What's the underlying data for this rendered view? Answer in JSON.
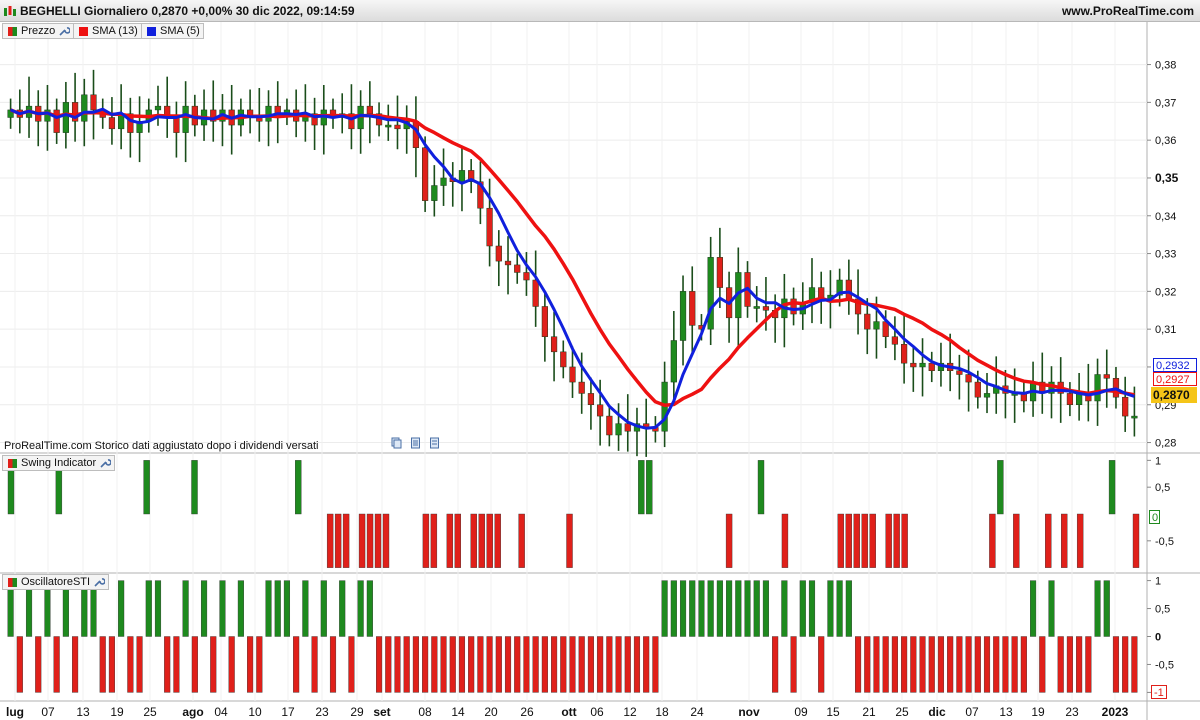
{
  "header": {
    "title": "BEGHELLI Giornaliero 0,2870 +0,00% 30 dic 2022, 09:14:59",
    "site": "www.ProRealTime.com"
  },
  "legend_price": {
    "prezzo": "Prezzo",
    "sma13": "SMA (13)",
    "sma5": "SMA (5)"
  },
  "legend_swing": "Swing Indicator",
  "legend_osc": "OscillatoreSTI",
  "note": "ProRealTime.com Storico dati aggiustato dopo i dividendi versati",
  "price_tags": {
    "sma5": "0,2932",
    "sma13": "0,2927",
    "last": "0,2870"
  },
  "swing_zero_tag": "0",
  "osc_min_tag": "-1",
  "colors": {
    "up": "#1e8a1e",
    "down": "#e0201a",
    "sma13": "#ee1111",
    "sma5": "#1020dd",
    "last_tag_bg": "#f5c518"
  },
  "icons": [
    "chart-app-icon",
    "wrench-icon",
    "copy-icon",
    "document-icon"
  ],
  "chart_data": [
    {
      "type": "candlestick",
      "title": "BEGHELLI Giornaliero",
      "y_ticks": [
        "0,28",
        "0,29",
        "0,3",
        "0,31",
        "0,32",
        "0,33",
        "0,34",
        "0,35",
        "0,36",
        "0,37",
        "0,38"
      ],
      "ylim": [
        0.2775,
        0.3865
      ],
      "x_ticks": [
        "lug",
        "07",
        "13",
        "19",
        "25",
        "ago",
        "04",
        "10",
        "17",
        "23",
        "29",
        "set",
        "08",
        "14",
        "20",
        "26",
        "ott",
        "06",
        "12",
        "18",
        "24",
        "nov",
        "09",
        "15",
        "21",
        "25",
        "dic",
        "07",
        "13",
        "19",
        "23",
        "2023"
      ],
      "series": [
        {
          "name": "Prezzo",
          "close": [
            0.368,
            0.366,
            0.369,
            0.365,
            0.368,
            0.362,
            0.37,
            0.365,
            0.372,
            0.368,
            0.366,
            0.363,
            0.367,
            0.362,
            0.365,
            0.368,
            0.369,
            0.366,
            0.362,
            0.369,
            0.364,
            0.368,
            0.365,
            0.368,
            0.364,
            0.368,
            0.366,
            0.365,
            0.369,
            0.367,
            0.368,
            0.365,
            0.367,
            0.364,
            0.368,
            0.366,
            0.367,
            0.363,
            0.369,
            0.367,
            0.364,
            0.364,
            0.363,
            0.365,
            0.358,
            0.344,
            0.348,
            0.35,
            0.349,
            0.352,
            0.349,
            0.342,
            0.332,
            0.328,
            0.327,
            0.325,
            0.323,
            0.316,
            0.308,
            0.304,
            0.3,
            0.296,
            0.293,
            0.29,
            0.287,
            0.282,
            0.285,
            0.283,
            0.285,
            0.284,
            0.283,
            0.296,
            0.307,
            0.32,
            0.311,
            0.31,
            0.329,
            0.321,
            0.313,
            0.325,
            0.316,
            0.316,
            0.315,
            0.313,
            0.318,
            0.314,
            0.317,
            0.321,
            0.318,
            0.319,
            0.323,
            0.318,
            0.314,
            0.31,
            0.312,
            0.308,
            0.306,
            0.301,
            0.3,
            0.301,
            0.299,
            0.301,
            0.299,
            0.298,
            0.296,
            0.292,
            0.293,
            0.295,
            0.293,
            0.293,
            0.291,
            0.296,
            0.293,
            0.296,
            0.293,
            0.29,
            0.293,
            0.291,
            0.298,
            0.297,
            0.292,
            0.287,
            0.287
          ]
        },
        {
          "name": "SMA (13)",
          "last": 0.2927
        },
        {
          "name": "SMA (5)",
          "last": 0.2932
        }
      ],
      "last_price": 0.287
    },
    {
      "type": "bar",
      "title": "Swing Indicator",
      "y_ticks": [
        "1",
        "0,5",
        "-0,5"
      ],
      "ylim": [
        -1.1,
        1.1
      ],
      "values_note": "per-day values are +1 (green) or -1 (red) or 0",
      "values": [
        1,
        0,
        0,
        0,
        0,
        0,
        1,
        0,
        0,
        0,
        0,
        0,
        0,
        0,
        0,
        0,
        0,
        1,
        0,
        0,
        0,
        0,
        0,
        1,
        0,
        0,
        0,
        0,
        0,
        0,
        0,
        0,
        0,
        0,
        0,
        0,
        1,
        0,
        0,
        0,
        -1,
        -1,
        -1,
        0,
        -1,
        -1,
        -1,
        -1,
        0,
        0,
        0,
        0,
        -1,
        -1,
        0,
        -1,
        -1,
        0,
        -1,
        -1,
        -1,
        -1,
        0,
        0,
        -1,
        0,
        0,
        0,
        0,
        0,
        -1,
        0,
        0,
        0,
        0,
        0,
        0,
        0,
        0,
        1,
        1,
        0,
        0,
        0,
        0,
        0,
        0,
        0,
        0,
        0,
        -1,
        0,
        0,
        0,
        1,
        0,
        0,
        -1,
        0,
        0,
        0,
        0,
        0,
        0,
        -1,
        -1,
        -1,
        -1,
        -1,
        0,
        -1,
        -1,
        -1,
        0,
        0,
        0,
        0,
        0,
        0,
        0,
        0,
        0,
        0,
        -1,
        1,
        0,
        -1,
        0,
        0,
        0,
        -1,
        0,
        -1,
        0,
        -1,
        0,
        0,
        0,
        1,
        0,
        0,
        -1
      ]
    },
    {
      "type": "bar",
      "title": "OscillatoreSTI",
      "y_ticks": [
        "1",
        "0,5",
        "0",
        "-0,5",
        "-1"
      ],
      "ylim": [
        -1.1,
        1.1
      ]
    }
  ]
}
